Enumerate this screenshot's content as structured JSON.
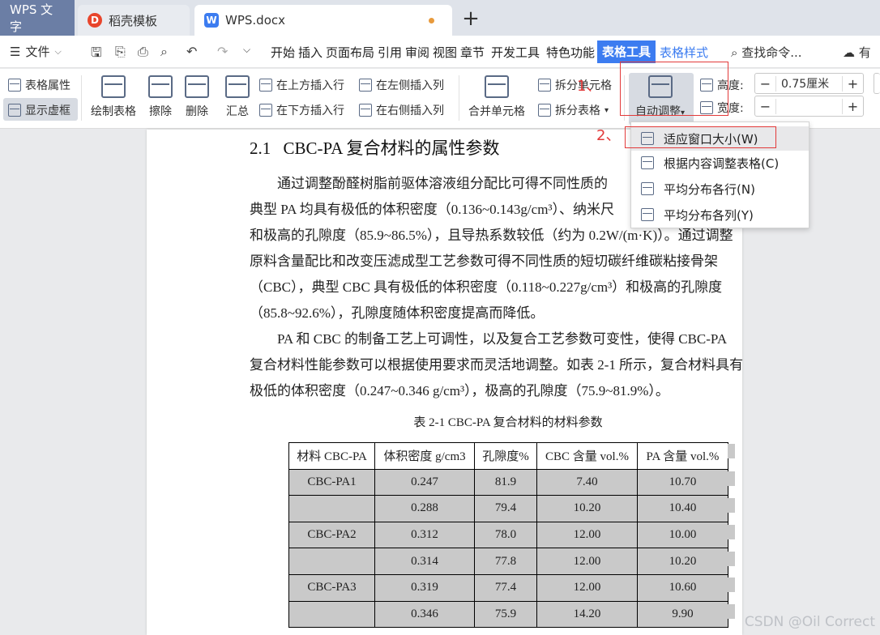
{
  "tabs": {
    "wps": "WPS 文字",
    "template": "稻壳模板",
    "doc": "WPS.docx",
    "new_tab": "+"
  },
  "menu": {
    "file": "文件",
    "items": [
      "开始",
      "插入",
      "页面布局",
      "引用",
      "审阅",
      "视图",
      "章节",
      "开发工具",
      "特色功能"
    ],
    "table_tools": "表格工具",
    "table_style": "表格样式",
    "search": "查找命令...",
    "cloud": "有"
  },
  "ribbon": {
    "table_props": "表格属性",
    "show_grid": "显示虚框",
    "draw_table": "绘制表格",
    "erase": "擦除",
    "delete": "删除",
    "summary": "汇总",
    "insert_above": "在上方插入行",
    "insert_below": "在下方插入行",
    "insert_left": "在左侧插入列",
    "insert_right": "在右侧插入列",
    "merge_cells": "合并单元格",
    "split_cells": "拆分单元格",
    "split_table": "拆分表格",
    "auto_fit": "自动调整",
    "height_label": "高度:",
    "height_value": "0.75厘米",
    "width_label": "宽度:",
    "width_value": "",
    "minus": "−",
    "plus": "+"
  },
  "annotations": {
    "step1": "1、",
    "step2": "2、"
  },
  "dropdown": {
    "items": [
      "适应窗口大小(W)",
      "根据内容调整表格(C)",
      "平均分布各行(N)",
      "平均分布各列(Y)"
    ]
  },
  "document": {
    "heading_num": "2.1",
    "heading_text": "CBC-PA 复合材料的属性参数",
    "para1": [
      "通过调整酚醛树脂前驱体溶液组分配比可得不同性质的",
      "典型 PA 均具有极低的体积密度（0.136~0.143g/cm³）、纳米尺",
      "和极高的孔隙度（85.9~86.5%），且导热系数较低（约为 0.2W/(m·K)）。通过调整",
      "原料含量配比和改变压滤成型工艺参数可得不同性质的短切碳纤维碳粘接骨架",
      "（CBC），典型 CBC 具有极低的体积密度（0.118~0.227g/cm³）和极高的孔隙度",
      "（85.8~92.6%），孔隙度随体积密度提高而降低。"
    ],
    "para2": [
      "PA 和 CBC 的制备工艺上可调性，以及复合工艺参数可变性，使得 CBC-PA",
      "复合材料性能参数可以根据使用要求而灵活地调整。如表 2-1 所示，复合材料具有",
      "极低的体积密度（0.247~0.346 g/cm³），极高的孔隙度（75.9~81.9%）。"
    ],
    "caption": "表 2-1 CBC-PA 复合材料的材料参数",
    "table": {
      "headers": [
        "材料 CBC-PA",
        "体积密度 g/cm3",
        "孔隙度%",
        "CBC 含量 vol.%",
        "PA 含量 vol.%"
      ],
      "rows": [
        [
          "CBC-PA1",
          "0.247",
          "81.9",
          "7.40",
          "10.70"
        ],
        [
          "",
          "0.288",
          "79.4",
          "10.20",
          "10.40"
        ],
        [
          "CBC-PA2",
          "0.312",
          "78.0",
          "12.00",
          "10.00"
        ],
        [
          "",
          "0.314",
          "77.8",
          "12.00",
          "10.20"
        ],
        [
          "CBC-PA3",
          "0.319",
          "77.4",
          "12.00",
          "10.60"
        ],
        [
          "",
          "0.346",
          "75.9",
          "14.20",
          "9.90"
        ]
      ]
    }
  },
  "watermark": "CSDN @Oil Correct"
}
